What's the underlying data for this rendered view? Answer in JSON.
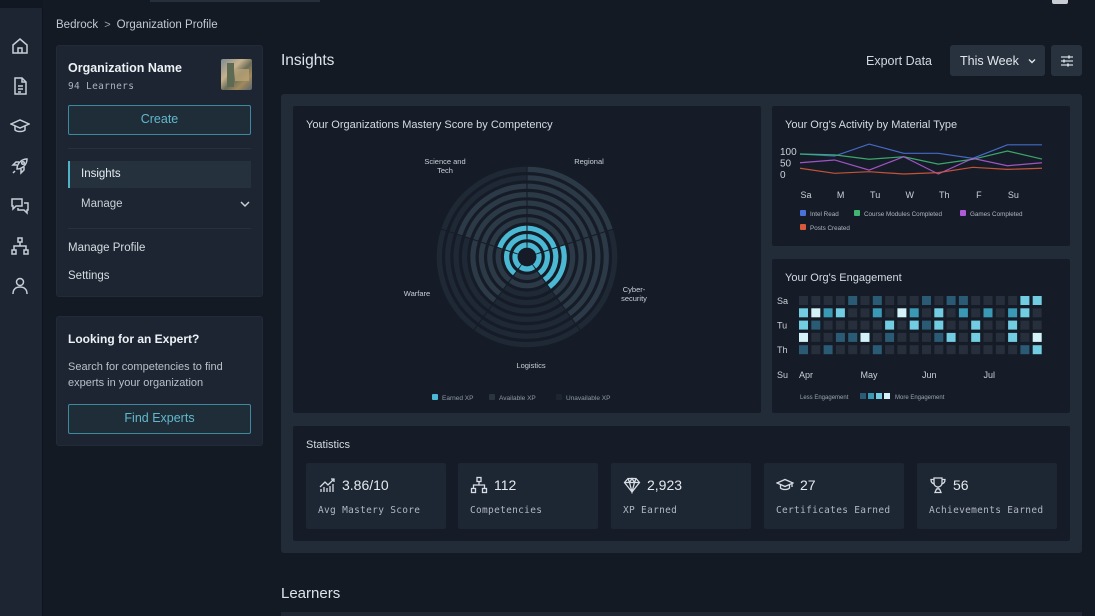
{
  "breadcrumb": {
    "root": "Bedrock",
    "separator": ">",
    "current": "Organization Profile"
  },
  "rail": {
    "icons": [
      "home-icon",
      "document-icon",
      "graduation-cap-icon",
      "rocket-icon",
      "chat-icon",
      "org-chart-icon",
      "user-icon"
    ]
  },
  "org": {
    "name": "Organization Name",
    "learners": "94 Learners",
    "create_label": "Create",
    "nav": {
      "insights": "Insights",
      "manage": "Manage",
      "manage_profile": "Manage Profile",
      "settings": "Settings"
    }
  },
  "expert": {
    "title": "Looking for an Expert?",
    "description": "Search for competencies to find experts in your organization",
    "button_label": "Find Experts"
  },
  "header": {
    "title": "Insights",
    "export_label": "Export Data",
    "period": "This Week",
    "filter_icon": "sliders-icon"
  },
  "colors": {
    "accent": "#4fb3c8",
    "earned": "#4bb9d3",
    "available": "#2c3947",
    "unavailable": "#1f2935"
  },
  "chart_data": [
    {
      "type": "radial-bar",
      "title": "Your Organizations Mastery Score by Competency",
      "max_level": 10,
      "categories": [
        "Regional",
        "Cyber-security",
        "Logistics",
        "Warfare",
        "Science and Tech"
      ],
      "category_lines": [
        [
          "Regional"
        ],
        [
          "Cyber-",
          "security"
        ],
        [
          "Logistics"
        ],
        [
          "Warfare"
        ],
        [
          "Science and",
          "Tech"
        ]
      ],
      "earned": [
        3,
        4,
        1,
        2,
        3
      ],
      "available": [
        10,
        9,
        3,
        6,
        8
      ],
      "legend": [
        "Earned XP",
        "Available XP",
        "Unavailable XP"
      ]
    },
    {
      "type": "line",
      "title": "Your Org's Activity by Material Type",
      "x": [
        "Sa",
        "M",
        "Tu",
        "W",
        "Th",
        "F",
        "Su",
        ""
      ],
      "yticks": [
        100,
        50,
        0
      ],
      "ylim": [
        0,
        140
      ],
      "series": [
        {
          "name": "Intel Read",
          "color": "#4a72d8",
          "values": [
            87,
            78,
            130,
            90,
            90,
            68,
            127,
            127
          ]
        },
        {
          "name": "Course Modules Completed",
          "color": "#3fb772",
          "values": [
            87,
            83,
            64,
            75,
            43,
            64,
            100,
            65
          ]
        },
        {
          "name": "Games Completed",
          "color": "#b05ad8",
          "values": [
            49,
            61,
            17,
            75,
            0,
            68,
            36,
            49
          ]
        },
        {
          "name": "Posts Created",
          "color": "#d9593a",
          "values": [
            25,
            3,
            10,
            0,
            6,
            29,
            20,
            25
          ]
        }
      ]
    },
    {
      "type": "heatmap",
      "title": "Your Org's Engagement",
      "row_labels": [
        "Sa",
        "",
        "Tu",
        "",
        "Th",
        "",
        "Su"
      ],
      "month_labels": [
        "Apr",
        "May",
        "Jun",
        "Jul"
      ],
      "month_columns": [
        0,
        5,
        10,
        15
      ],
      "levels": 5,
      "palette": [
        "#262f3b",
        "#2a5a74",
        "#3a9ab6",
        "#72cde2",
        "#d3f3f9"
      ],
      "legend_less": "Less Engagement",
      "legend_more": "More Engagement",
      "values": [
        [
          0,
          0,
          0,
          0,
          1,
          0,
          1,
          0,
          0,
          0,
          1,
          0,
          1,
          1,
          0,
          0,
          0,
          0,
          3,
          3
        ],
        [
          3,
          4,
          2,
          3,
          0,
          0,
          2,
          0,
          4,
          2,
          0,
          3,
          0,
          2,
          0,
          2,
          0,
          2,
          3,
          0
        ],
        [
          3,
          1,
          0,
          0,
          0,
          0,
          0,
          3,
          0,
          3,
          1,
          3,
          0,
          0,
          3,
          0,
          0,
          3,
          0,
          0
        ],
        [
          4,
          0,
          0,
          1,
          1,
          4,
          0,
          1,
          0,
          0,
          0,
          1,
          3,
          0,
          3,
          0,
          0,
          3,
          0,
          4
        ],
        [
          1,
          0,
          1,
          0,
          0,
          0,
          1,
          0,
          0,
          0,
          0,
          0,
          0,
          0,
          0,
          0,
          0,
          0,
          1,
          3
        ]
      ]
    }
  ],
  "statistics": {
    "title": "Statistics",
    "items": [
      {
        "icon": "chart-growth-icon",
        "value": "3.86/10",
        "label": "Avg Mastery Score"
      },
      {
        "icon": "org-chart-icon",
        "value": "112",
        "label": "Competencies"
      },
      {
        "icon": "diamond-icon",
        "value": "2,923",
        "label": "XP Earned"
      },
      {
        "icon": "graduation-cap-icon",
        "value": "27",
        "label": "Certificates Earned"
      },
      {
        "icon": "trophy-icon",
        "value": "56",
        "label": "Achievements Earned"
      }
    ]
  },
  "learners": {
    "title": "Learners"
  }
}
